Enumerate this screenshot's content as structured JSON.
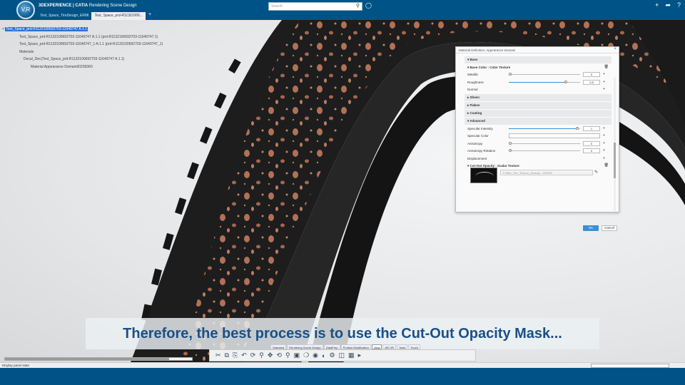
{
  "app": {
    "brand": "3DEXPERIENCE | CATIA",
    "app_name": "Rendering Scene Design",
    "compass_label": "V,R"
  },
  "search": {
    "placeholder": "Search"
  },
  "tabs": [
    {
      "label": "Test_Space_TireDesign_ERMI"
    },
    {
      "label": "Test_Space_prd-R11321006..."
    }
  ],
  "tree": [
    {
      "label": "Test_Space_prd-R1132100692703-11649747 A.1.1",
      "level": 0,
      "selected": true
    },
    {
      "label": "Test_Space_prd-R1132100692703-11649747 A.1.1 (prd-R1132100692703-11649747.1)",
      "level": 1
    },
    {
      "label": "Test_Space_prd-R1132100692703-11649747_1 A.1.1 (prd-R1132100692703-11649747_1)",
      "level": 1
    },
    {
      "label": "Materials",
      "level": 1
    },
    {
      "label": "Decal_Dec(Test_Space_prd-R1132100692703-11649747 A.1.1)",
      "level": 2
    },
    {
      "label": "Material Appearance Domain00299360",
      "level": 3
    }
  ],
  "dialog": {
    "title": "Material Definition: Appearance Domain",
    "base_section": "Base",
    "base_color": "Base Color : Color Texture",
    "metallic_label": "Metallic",
    "metallic_value": "0",
    "metallic_level": 0,
    "roughness_label": "Roughness",
    "roughness_value": "0.8",
    "roughness_level": 0.8,
    "normal_label": "Normal",
    "sheen": "Sheen",
    "flakes": "Flakes",
    "coating": "Coating",
    "advanced": "Advanced",
    "specular_intensity_label": "Specular Intensity",
    "specular_intensity_value": "1",
    "specular_intensity_level": 1,
    "specular_color_label": "Specular Color",
    "anisotropy_label": "Anisotropy",
    "anisotropy_value": "0",
    "anisotropy_rotation_label": "Anisotropy Rotation",
    "anisotropy_rotation_value": "0",
    "displacement_label": "Displacement",
    "cutout_label": "Cut-Out Opacity : Scalar Texture",
    "texture_name": "E-Bike_Tire_Texture_Opacity - 282993",
    "ok_label": "OK",
    "cancel_label": "Cancel"
  },
  "caption": "Therefore, the best process is to use the Cut-Out Opacity Mask...",
  "action_tabs": [
    "Standard",
    "Rendering Scene Design",
    "DataPrep",
    "Product Modification",
    "View",
    "AR-VR",
    "Tools",
    "Touch"
  ],
  "active_tab": "View",
  "status": {
    "text": "Display panel state"
  },
  "colors": {
    "topbar": "#005386",
    "accent": "#3a8fd6",
    "caption_text": "#1b4f86",
    "speckle": "#c27a5c"
  }
}
